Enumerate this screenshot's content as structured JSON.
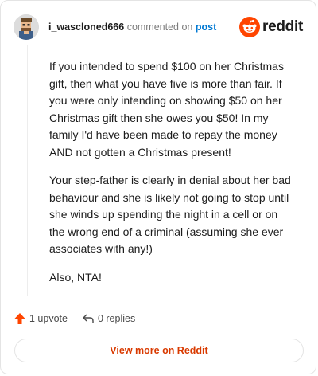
{
  "header": {
    "username": "i_wascloned666",
    "action": "commented on",
    "post_link": "post"
  },
  "logo": {
    "wordmark": "reddit",
    "brand_color": "#ff4500"
  },
  "comment": {
    "paragraphs": [
      "If you intended to spend $100 on her Christmas gift, then what you have five is more than fair. If you were only intending on showing $50 on her Christmas gift then she owes you $50! In my family I'd have been made to repay the money AND not gotten a Christmas present!",
      "Your step-father is clearly in denial about her bad behaviour and she is likely not going to stop until she winds up spending the night in a cell or on the wrong end of a criminal (assuming she ever associates with any!)",
      "Also, NTA!"
    ]
  },
  "footer": {
    "upvotes": "1 upvote",
    "replies": "0 replies",
    "upvote_color": "#ff4500"
  },
  "view_more": {
    "label": "View more on Reddit",
    "color": "#d93a00"
  }
}
